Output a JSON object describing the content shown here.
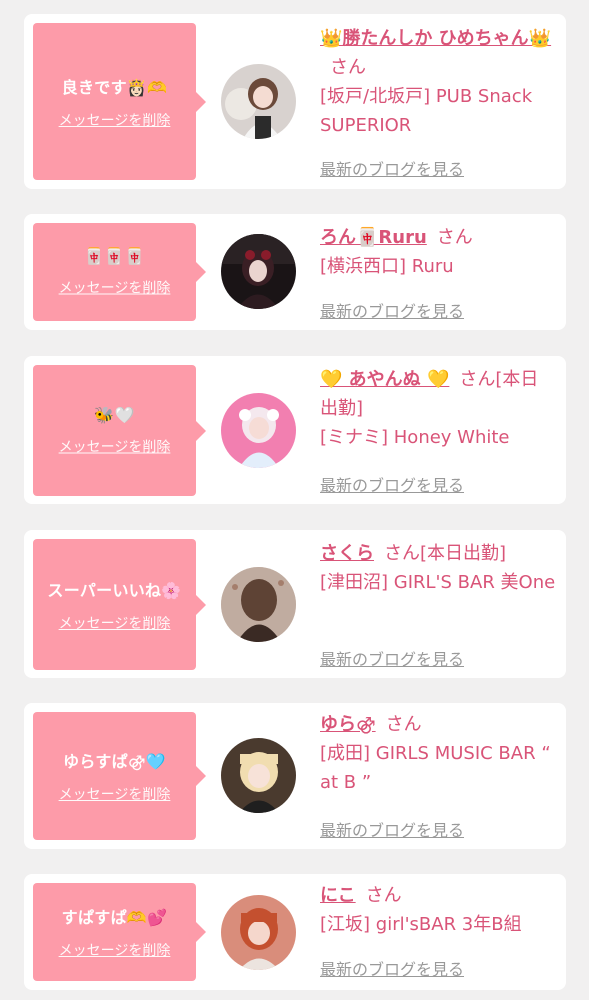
{
  "entries": [
    {
      "message": "良きです👸🏻🫶",
      "delete_label": "メッセージを削除",
      "name": "👑勝たんしか ひめちゃん👑",
      "san": "さん",
      "shop": "[坂戸/北坂戸] PUB Snack SUPERIOR",
      "blog": "最新のブログを見る"
    },
    {
      "message": "🀄🀄🀄",
      "delete_label": "メッセージを削除",
      "name": "ろん🀄Ruru",
      "san": "さん",
      "shop": "[横浜西口] Ruru",
      "blog": "最新のブログを見る"
    },
    {
      "message": "🐝🤍",
      "delete_label": "メッセージを削除",
      "name": "💛 あやんぬ 💛",
      "san": "さん[本日出勤]",
      "shop": "[ミナミ] Honey White",
      "blog": "最新のブログを見る"
    },
    {
      "message": "スーパーいいね🌸",
      "delete_label": "メッセージを削除",
      "name": "さくら",
      "san": "さん[本日出勤]",
      "shop": "[津田沼] GIRL'S BAR 美One",
      "blog": "最新のブログを見る"
    },
    {
      "message": "ゆらすぱ⚣🩵",
      "delete_label": "メッセージを削除",
      "name": "ゆら⚣",
      "san": "さん",
      "shop": "[成田] GIRLS MUSIC BAR “ at B ”",
      "blog": "最新のブログを見る"
    },
    {
      "message": "すぱすぱ🫶💕",
      "delete_label": "メッセージを削除",
      "name": "にこ",
      "san": "さん",
      "shop": "[江坂] girl'sBAR 3年B組",
      "blog": "最新のブログを見る"
    }
  ]
}
